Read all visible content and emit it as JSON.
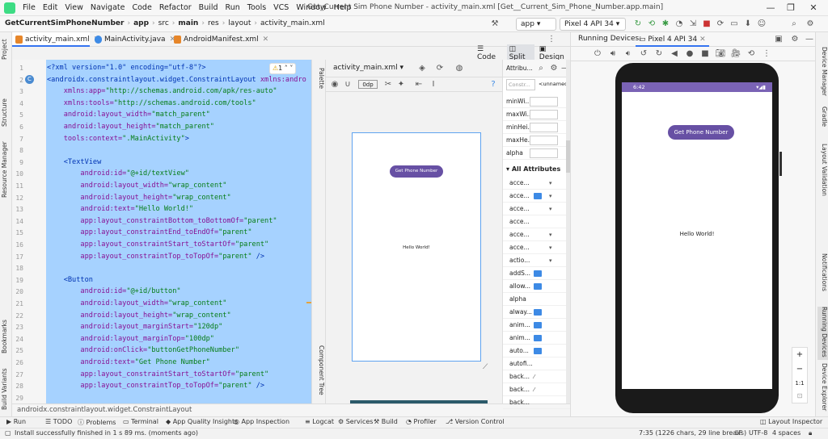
{
  "menubar": {
    "items": [
      "File",
      "Edit",
      "View",
      "Navigate",
      "Code",
      "Refactor",
      "Build",
      "Run",
      "Tools",
      "VCS",
      "Window",
      "Help"
    ],
    "title": "Get_Current Sim Phone Number - activity_main.xml [Get__Current_Sim_Phone_Number.app.main]"
  },
  "navbar": {
    "project": "GetCurrentSimPhoneNumber",
    "crumbs": [
      "app",
      "src",
      "main",
      "res",
      "layout",
      "activity_main.xml"
    ],
    "run_config": "app",
    "device": "Pixel 4 API 34"
  },
  "left_strip": [
    "Project",
    "Structure",
    "Resource Manager",
    "Bookmarks",
    "Build Variants"
  ],
  "right_strip": [
    "Device Manager",
    "Gradle",
    "Layout Validation",
    "Notifications",
    "Running Devices",
    "Device Explorer"
  ],
  "tabs": [
    "activity_main.xml",
    "MainActivity.java",
    "AndroidManifest.xml"
  ],
  "view_modes": [
    "Code",
    "Split",
    "Design"
  ],
  "editor": {
    "warning_count": "1",
    "line_numbers": [
      "1",
      "2",
      "3",
      "4",
      "5",
      "6",
      "7",
      "8",
      "9",
      "10",
      "11",
      "12",
      "13",
      "14",
      "15",
      "16",
      "17",
      "18",
      "19",
      "20",
      "21",
      "22",
      "23",
      "24",
      "25",
      "26",
      "27",
      "28",
      "29"
    ],
    "lines": [
      {
        "parts": [
          {
            "c": "tag",
            "t": "<?xml version=\"1.0\" encoding=\"utf-8\"?>"
          }
        ]
      },
      {
        "parts": [
          {
            "c": "tag",
            "t": "<androidx.constraintlayout.widget.ConstraintLayout "
          },
          {
            "c": "attr",
            "t": "xmlns:andro"
          }
        ]
      },
      {
        "parts": [
          {
            "c": "attr",
            "t": "    xmlns:app="
          },
          {
            "c": "val",
            "t": "\"http://schemas.android.com/apk/res-auto\""
          }
        ]
      },
      {
        "parts": [
          {
            "c": "attr",
            "t": "    xmlns:tools="
          },
          {
            "c": "val",
            "t": "\"http://schemas.android.com/tools\""
          }
        ]
      },
      {
        "parts": [
          {
            "c": "attr",
            "t": "    android:layout_width="
          },
          {
            "c": "val",
            "t": "\"match_parent\""
          }
        ]
      },
      {
        "parts": [
          {
            "c": "attr",
            "t": "    android:layout_height="
          },
          {
            "c": "val",
            "t": "\"match_parent\""
          }
        ]
      },
      {
        "parts": [
          {
            "c": "attr",
            "t": "    tools:context="
          },
          {
            "c": "val",
            "t": "\".MainActivity\""
          },
          {
            "c": "tag",
            "t": ">"
          }
        ]
      },
      {
        "parts": [
          {
            "c": "tag",
            "t": ""
          }
        ]
      },
      {
        "parts": [
          {
            "c": "tag",
            "t": "    <TextView"
          }
        ]
      },
      {
        "parts": [
          {
            "c": "attr",
            "t": "        android:id="
          },
          {
            "c": "val",
            "t": "\"@+id/textView\""
          }
        ]
      },
      {
        "parts": [
          {
            "c": "attr",
            "t": "        android:layout_width="
          },
          {
            "c": "val",
            "t": "\"wrap_content\""
          }
        ]
      },
      {
        "parts": [
          {
            "c": "attr",
            "t": "        android:layout_height="
          },
          {
            "c": "val",
            "t": "\"wrap_content\""
          }
        ]
      },
      {
        "parts": [
          {
            "c": "attr",
            "t": "        android:text="
          },
          {
            "c": "val",
            "t": "\"Hello World!\""
          }
        ]
      },
      {
        "parts": [
          {
            "c": "attr",
            "t": "        app:layout_constraintBottom_toBottomOf="
          },
          {
            "c": "val",
            "t": "\"parent\""
          }
        ]
      },
      {
        "parts": [
          {
            "c": "attr",
            "t": "        app:layout_constraintEnd_toEndOf="
          },
          {
            "c": "val",
            "t": "\"parent\""
          }
        ]
      },
      {
        "parts": [
          {
            "c": "attr",
            "t": "        app:layout_constraintStart_toStartOf="
          },
          {
            "c": "val",
            "t": "\"parent\""
          }
        ]
      },
      {
        "parts": [
          {
            "c": "attr",
            "t": "        app:layout_constraintTop_toTopOf="
          },
          {
            "c": "val",
            "t": "\"parent\""
          },
          {
            "c": "tag",
            "t": " />"
          }
        ]
      },
      {
        "parts": [
          {
            "c": "tag",
            "t": ""
          }
        ]
      },
      {
        "parts": [
          {
            "c": "tag",
            "t": "    <Button"
          }
        ]
      },
      {
        "parts": [
          {
            "c": "attr",
            "t": "        android:id="
          },
          {
            "c": "val",
            "t": "\"@+id/button\""
          }
        ]
      },
      {
        "parts": [
          {
            "c": "attr",
            "t": "        android:layout_width="
          },
          {
            "c": "val",
            "t": "\"wrap_content\""
          }
        ]
      },
      {
        "parts": [
          {
            "c": "attr",
            "t": "        android:layout_height="
          },
          {
            "c": "val",
            "t": "\"wrap_content\""
          }
        ]
      },
      {
        "parts": [
          {
            "c": "attr",
            "t": "        android:layout_marginStart="
          },
          {
            "c": "val",
            "t": "\"120dp\""
          }
        ]
      },
      {
        "parts": [
          {
            "c": "attr",
            "t": "        android:layout_marginTop="
          },
          {
            "c": "val",
            "t": "\"100dp\""
          }
        ]
      },
      {
        "parts": [
          {
            "c": "attr",
            "t": "        android:onClick="
          },
          {
            "c": "val",
            "t": "\"buttonGetPhoneNumber\""
          }
        ]
      },
      {
        "parts": [
          {
            "c": "attr",
            "t": "        android:text="
          },
          {
            "c": "val",
            "t": "\"Get Phone Number\""
          }
        ]
      },
      {
        "parts": [
          {
            "c": "attr",
            "t": "        app:layout_constraintStart_toStartOf="
          },
          {
            "c": "val",
            "t": "\"parent\""
          }
        ]
      },
      {
        "parts": [
          {
            "c": "attr",
            "t": "        app:layout_constraintTop_toTopOf="
          },
          {
            "c": "val",
            "t": "\"parent\""
          },
          {
            "c": "tag",
            "t": " />"
          }
        ]
      },
      {
        "parts": [
          {
            "c": "tag",
            "t": ""
          }
        ]
      }
    ],
    "breadcrumb": "androidx.constraintlayout.widget.ConstraintLayout"
  },
  "palette_labels": [
    "Palette",
    "Component Tree"
  ],
  "design": {
    "file": "activity_main.xml",
    "dp": "0dp",
    "button_text": "Get Phone Number",
    "hello_text": "Hello World!"
  },
  "attributes": {
    "title": "Attribu...",
    "search_placeholder": "Constr...",
    "unnamed": "<unnamed...",
    "top_rows": [
      "minWi...",
      "maxWi...",
      "minHei...",
      "maxHe...",
      "alpha"
    ],
    "section": "All Attributes",
    "rows": [
      "acce...",
      "acce...",
      "acce...",
      "acce...",
      "acce...",
      "acce...",
      "actio...",
      "addS...",
      "allow...",
      "alpha",
      "alway...",
      "anim...",
      "anim...",
      "auto...",
      "autofi...",
      "back...",
      "back...",
      "back..."
    ]
  },
  "running": {
    "title": "Running Devices:",
    "device_tab": "Pixel 4 API 34",
    "time": "6:42",
    "button_text": "Get Phone Number",
    "hello_text": "Hello World!",
    "zoom": [
      "+",
      "−",
      "1:1"
    ]
  },
  "bottom_tools": [
    "Run",
    "TODO",
    "Problems",
    "Terminal",
    "App Quality Insights",
    "App Inspection",
    "Logcat",
    "Services",
    "Build",
    "Profiler",
    "Version Control",
    "Layout Inspector"
  ],
  "status": {
    "message": "Install successfully finished in 1 s 89 ms. (moments ago)",
    "position": "7:35 (1226 chars, 29 line breaks)",
    "line_sep": "LF",
    "encoding": "UTF-8",
    "indent": "4 spaces"
  },
  "colors": {
    "accent": "#3574f0",
    "button": "#6750a4",
    "selection": "#a6d2ff"
  }
}
